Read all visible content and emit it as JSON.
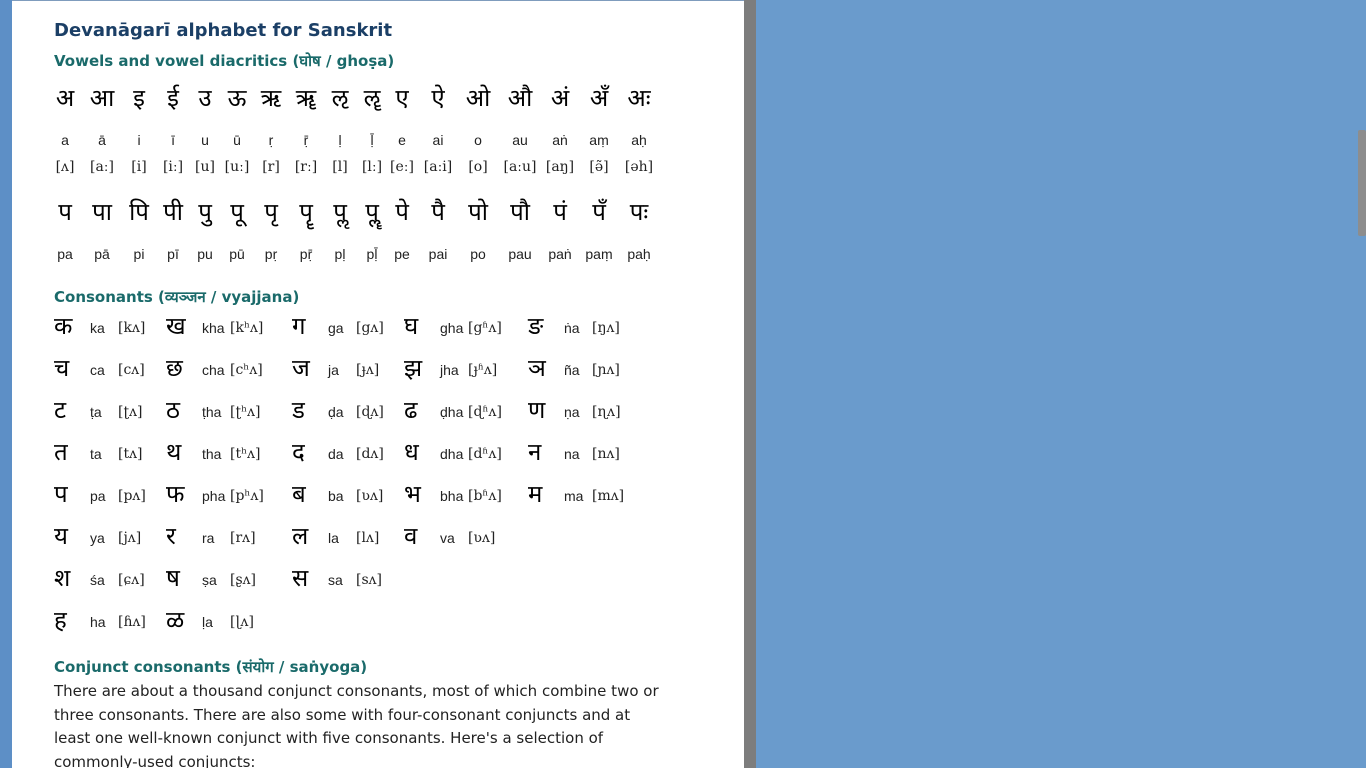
{
  "title": "Devanāgarī alphabet for Sanskrit",
  "vowels": {
    "heading": "Vowels and vowel diacritics (घोष / ghoṣa)",
    "items": [
      {
        "deva": "अ",
        "rom": "a",
        "ipa": "[ʌ]"
      },
      {
        "deva": "आ",
        "rom": "ā",
        "ipa": "[aː]"
      },
      {
        "deva": "इ",
        "rom": "i",
        "ipa": "[i]"
      },
      {
        "deva": "ई",
        "rom": "ī",
        "ipa": "[iː]"
      },
      {
        "deva": "उ",
        "rom": "u",
        "ipa": "[u]"
      },
      {
        "deva": "ऊ",
        "rom": "ū",
        "ipa": "[uː]"
      },
      {
        "deva": "ऋ",
        "rom": "ṛ",
        "ipa": "[r]"
      },
      {
        "deva": "ॠ",
        "rom": "ṝ",
        "ipa": "[rː]"
      },
      {
        "deva": "ऌ",
        "rom": "ḷ",
        "ipa": "[l]"
      },
      {
        "deva": "ॡ",
        "rom": "ḹ",
        "ipa": "[lː]"
      },
      {
        "deva": "ए",
        "rom": "e",
        "ipa": "[eː]"
      },
      {
        "deva": "ऐ",
        "rom": "ai",
        "ipa": "[aːi]"
      },
      {
        "deva": "ओ",
        "rom": "o",
        "ipa": "[o]"
      },
      {
        "deva": "औ",
        "rom": "au",
        "ipa": "[aːu]"
      },
      {
        "deva": "अं",
        "rom": "aṅ",
        "ipa": "[aŋ]"
      },
      {
        "deva": "अँ",
        "rom": "aṃ",
        "ipa": "[ə̃]"
      },
      {
        "deva": "अः",
        "rom": "aḥ",
        "ipa": "[əh]"
      }
    ],
    "diacritics": [
      {
        "deva": "प",
        "rom": "pa"
      },
      {
        "deva": "पा",
        "rom": "pā"
      },
      {
        "deva": "पि",
        "rom": "pi"
      },
      {
        "deva": "पी",
        "rom": "pī"
      },
      {
        "deva": "पु",
        "rom": "pu"
      },
      {
        "deva": "पू",
        "rom": "pū"
      },
      {
        "deva": "पृ",
        "rom": "pṛ"
      },
      {
        "deva": "पॄ",
        "rom": "pṝ"
      },
      {
        "deva": "पॢ",
        "rom": "pḷ"
      },
      {
        "deva": "पॣ",
        "rom": "pḹ"
      },
      {
        "deva": "पे",
        "rom": "pe"
      },
      {
        "deva": "पै",
        "rom": "pai"
      },
      {
        "deva": "पो",
        "rom": "po"
      },
      {
        "deva": "पौ",
        "rom": "pau"
      },
      {
        "deva": "पं",
        "rom": "paṅ"
      },
      {
        "deva": "पँ",
        "rom": "paṃ"
      },
      {
        "deva": "पः",
        "rom": "paḥ"
      }
    ]
  },
  "consonants": {
    "heading": "Consonants (व्यञ्जन / vyajjana)",
    "rows": [
      [
        {
          "deva": "क",
          "rom": "ka",
          "ipa": "[kʌ]"
        },
        {
          "deva": "ख",
          "rom": "kha",
          "ipa": "[kʰʌ]"
        },
        {
          "deva": "ग",
          "rom": "ga",
          "ipa": "[gʌ]"
        },
        {
          "deva": "घ",
          "rom": "gha",
          "ipa": "[gʱʌ]"
        },
        {
          "deva": "ङ",
          "rom": "ṅa",
          "ipa": "[ŋʌ]"
        }
      ],
      [
        {
          "deva": "च",
          "rom": "ca",
          "ipa": "[cʌ]"
        },
        {
          "deva": "छ",
          "rom": "cha",
          "ipa": "[cʰʌ]"
        },
        {
          "deva": "ज",
          "rom": "ja",
          "ipa": "[ɟʌ]"
        },
        {
          "deva": "झ",
          "rom": "jha",
          "ipa": "[ɟʱʌ]"
        },
        {
          "deva": "ञ",
          "rom": "ña",
          "ipa": "[ɲʌ]"
        }
      ],
      [
        {
          "deva": "ट",
          "rom": "ṭa",
          "ipa": "[ʈʌ]"
        },
        {
          "deva": "ठ",
          "rom": "ṭha",
          "ipa": "[ʈʰʌ]"
        },
        {
          "deva": "ड",
          "rom": "ḍa",
          "ipa": "[ɖʌ]"
        },
        {
          "deva": "ढ",
          "rom": "ḍha",
          "ipa": "[ɖʱʌ]"
        },
        {
          "deva": "ण",
          "rom": "ṇa",
          "ipa": "[ɳʌ]"
        }
      ],
      [
        {
          "deva": "त",
          "rom": "ta",
          "ipa": "[tʌ]"
        },
        {
          "deva": "थ",
          "rom": "tha",
          "ipa": "[tʰʌ]"
        },
        {
          "deva": "द",
          "rom": "da",
          "ipa": "[dʌ]"
        },
        {
          "deva": "ध",
          "rom": "dha",
          "ipa": "[dʱʌ]"
        },
        {
          "deva": "न",
          "rom": "na",
          "ipa": "[nʌ]"
        }
      ],
      [
        {
          "deva": "प",
          "rom": "pa",
          "ipa": "[pʌ]"
        },
        {
          "deva": "फ",
          "rom": "pha",
          "ipa": "[pʰʌ]"
        },
        {
          "deva": "ब",
          "rom": "ba",
          "ipa": "[ʋʌ]"
        },
        {
          "deva": "भ",
          "rom": "bha",
          "ipa": "[bʱʌ]"
        },
        {
          "deva": "म",
          "rom": "ma",
          "ipa": "[mʌ]"
        }
      ],
      [
        {
          "deva": "य",
          "rom": "ya",
          "ipa": "[jʌ]"
        },
        {
          "deva": "र",
          "rom": "ra",
          "ipa": "[rʌ]"
        },
        {
          "deva": "ल",
          "rom": "la",
          "ipa": "[lʌ]"
        },
        {
          "deva": "व",
          "rom": "va",
          "ipa": "[ʋʌ]"
        }
      ],
      [
        {
          "deva": "श",
          "rom": "śa",
          "ipa": "[ɕʌ]"
        },
        {
          "deva": "ष",
          "rom": "ṣa",
          "ipa": "[ʂʌ]"
        },
        {
          "deva": "स",
          "rom": "sa",
          "ipa": "[sʌ]"
        }
      ],
      [
        {
          "deva": "ह",
          "rom": "ha",
          "ipa": "[ɦʌ]"
        },
        {
          "deva": "ळ",
          "rom": "ḷa",
          "ipa": "[ɭʌ]"
        }
      ]
    ]
  },
  "conjuncts": {
    "heading": "Conjunct consonants (संयोग / saṅyoga)",
    "text": "There are about a thousand conjunct consonants, most of which combine two or three consonants. There are also some with four-consonant conjuncts and at least one well-known conjunct with five consonants. Here's a selection of commonly-used conjuncts:"
  },
  "colors": {
    "title": "#1b3f66",
    "heading": "#1a6a6a",
    "background": "#6a9bcc"
  }
}
